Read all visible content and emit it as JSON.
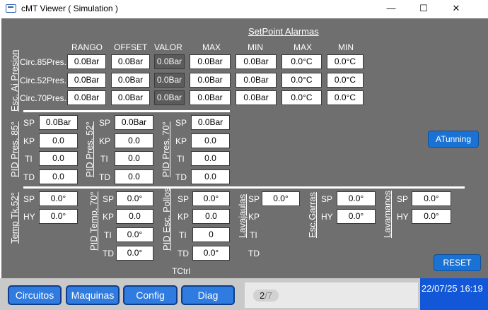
{
  "window": {
    "title": "cMT Viewer ( Simulation )",
    "minimize": "—",
    "maximize": "☐",
    "close": "✕"
  },
  "alarms_title": "SetPoint Alarmas",
  "pressure": {
    "section_label": "Esc. Ai Presion",
    "headers": [
      "RANGO",
      "OFFSET",
      "VALOR",
      "MAX",
      "MIN",
      "MAX",
      "MIN"
    ],
    "rows": [
      {
        "name": "Circ.85Pres.",
        "values": [
          "0.0Bar",
          "0.0Bar",
          "0.0Bar",
          "0.0Bar",
          "0.0Bar",
          "0.0°C",
          "0.0°C"
        ]
      },
      {
        "name": "Circ.52Pres.",
        "values": [
          "0.0Bar",
          "0.0Bar",
          "0.0Bar",
          "0.0Bar",
          "0.0Bar",
          "0.0°C",
          "0.0°C"
        ]
      },
      {
        "name": "Circ.70Pres.",
        "values": [
          "0.0Bar",
          "0.0Bar",
          "0.0Bar",
          "0.0Bar",
          "0.0Bar",
          "0.0°C",
          "0.0°C"
        ]
      }
    ]
  },
  "pid_pressure": [
    {
      "label": "PID Pres. 85°",
      "sp": "0.0Bar",
      "kp": "0.0",
      "ti": "0.0",
      "td": "0.0"
    },
    {
      "label": "PID Pres. 52°",
      "sp": "0.0Bar",
      "kp": "0.0",
      "ti": "0.0",
      "td": "0.0"
    },
    {
      "label": "PID Pres. 70°",
      "sp": "0.0Bar",
      "kp": "0.0",
      "ti": "0.0",
      "td": "0.0"
    }
  ],
  "param_labels": {
    "sp": "SP",
    "kp": "KP",
    "ti": "TI",
    "td": "TD",
    "hy": "HY"
  },
  "atunning_label": "ATunning",
  "temp_tk52": {
    "label": "Temp Tk.52°",
    "sp": "0.0°",
    "hy": "0.0°"
  },
  "pid_temp70": {
    "label": "PID Temp. 70°",
    "sp": "0.0°",
    "kp": "0.0",
    "ti": "0.0°",
    "td": "0.0°"
  },
  "pid_esc_pollos": {
    "label": "PID Esc. Pollos",
    "sp": "0.0°",
    "kp": "0.0",
    "ti": "0",
    "td": "0.0°"
  },
  "lavajaulas": {
    "label": "Lavajaulas",
    "sp": "0.0°"
  },
  "esc_garras": {
    "label": "Esc.Garras",
    "sp": "0.0°",
    "hy": "0.0°"
  },
  "lavamanos": {
    "label": "Lavamanos",
    "sp": "0.0°",
    "hy": "0.0°"
  },
  "tctrl_label": "TCtrl",
  "reset_label": "RESET",
  "nav": [
    "Circuitos",
    "Maquinas",
    "Config",
    "Diag"
  ],
  "page": {
    "current": "2",
    "total": "/7"
  },
  "clock": "22/07/25 16:19"
}
